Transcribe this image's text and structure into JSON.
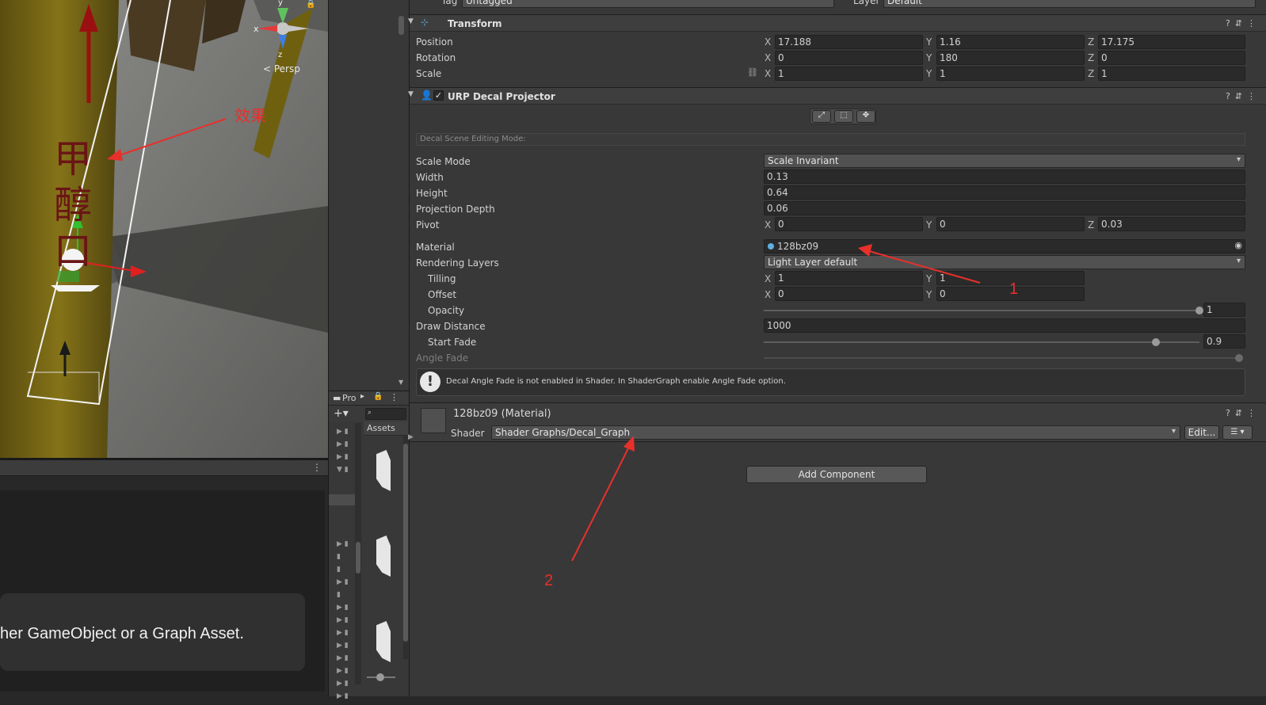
{
  "scene": {
    "gizmo": {
      "x_label": "x",
      "y_label": "y",
      "z_label": "z",
      "persp_label": "< Persp"
    },
    "annotation_label": "效果",
    "decal_text": [
      "甲",
      "醇",
      "口"
    ]
  },
  "graph": {
    "message": "her GameObject or a Graph Asset."
  },
  "project": {
    "tab_label": "Pro",
    "assets_label": "Assets",
    "search_placeholder": ""
  },
  "inspector": {
    "top": {
      "tag_label": "Tag",
      "tag_value": "Untagged",
      "layer_label": "Layer",
      "layer_value": "Default"
    },
    "transform": {
      "title": "Transform",
      "position": {
        "label": "Position",
        "x": "17.188",
        "y": "1.16",
        "z": "17.175"
      },
      "rotation": {
        "label": "Rotation",
        "x": "0",
        "y": "180",
        "z": "0"
      },
      "scale": {
        "label": "Scale",
        "x": "1",
        "y": "1",
        "z": "1"
      }
    },
    "decal": {
      "title": "URP Decal Projector",
      "editing_mode_label": "Decal Scene Editing Mode:",
      "scale_mode": {
        "label": "Scale Mode",
        "value": "Scale Invariant"
      },
      "width": {
        "label": "Width",
        "value": "0.13"
      },
      "height": {
        "label": "Height",
        "value": "0.64"
      },
      "projection_depth": {
        "label": "Projection Depth",
        "value": "0.06"
      },
      "pivot": {
        "label": "Pivot",
        "x": "0",
        "y": "0",
        "z": "0.03"
      },
      "material": {
        "label": "Material",
        "value": "128bz09"
      },
      "rendering_layers": {
        "label": "Rendering Layers",
        "value": "Light Layer default"
      },
      "tilling": {
        "label": "Tilling",
        "x": "1",
        "y": "1"
      },
      "offset": {
        "label": "Offset",
        "x": "0",
        "y": "0"
      },
      "opacity": {
        "label": "Opacity",
        "value": "1",
        "level": 1.0
      },
      "draw_distance": {
        "label": "Draw Distance",
        "value": "1000"
      },
      "start_fade": {
        "label": "Start Fade",
        "value": "0.9",
        "level": 0.9
      },
      "angle_fade": {
        "label": "Angle Fade"
      },
      "warning": "Decal Angle Fade is not enabled in Shader. In ShaderGraph enable Angle Fade option."
    },
    "material_section": {
      "title": "128bz09 (Material)",
      "shader_label": "Shader",
      "shader_value": "Shader Graphs/Decal_Graph",
      "edit_label": "Edit..."
    },
    "add_component_label": "Add Component"
  },
  "annotations": {
    "one": "1",
    "two": "2"
  },
  "colors": {
    "annotation": "#e8302a",
    "inspector_bg": "#383838",
    "field_bg": "#2a2a2a"
  }
}
